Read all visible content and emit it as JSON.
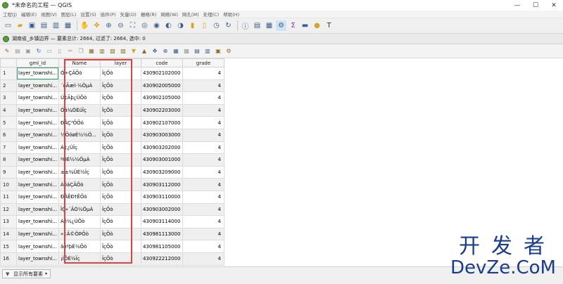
{
  "window": {
    "title": "*未命名的工程 — QGIS",
    "controls": [
      "—",
      "☐",
      "✕"
    ]
  },
  "menubar": {
    "items": [
      "工程(J)",
      "编辑(E)",
      "视图(V)",
      "图层(L)",
      "设置(S)",
      "插件(P)",
      "矢量(O)",
      "栅格(R)",
      "网络(W)",
      "网孔(M)",
      "处理(C)",
      "帮助(H)"
    ]
  },
  "toolbar": {
    "icons": [
      "new-project-icon",
      "open-project-icon",
      "save-project-icon",
      "save-as-icon",
      "print-layout-icon",
      "layout-manager-icon",
      "pan-icon",
      "pan-to-selection-icon",
      "zoom-in-icon",
      "zoom-out-icon",
      "zoom-full-icon",
      "zoom-to-selection-icon",
      "zoom-to-layer-icon",
      "zoom-last-icon",
      "zoom-next-icon",
      "new-bookmark-icon",
      "show-bookmarks-icon",
      "temporal-icon",
      "refresh-icon",
      "identify-icon",
      "attribute-table-icon",
      "field-calc-icon",
      "settings-gear-icon",
      "sum-icon",
      "measure-icon",
      "map-tips-icon",
      "text-annotation-icon"
    ]
  },
  "attribute_window": {
    "title": "湖南省_乡镇边界 — 要素总计: 2664, 过滤了: 2664, 选中: 0"
  },
  "table": {
    "columns": [
      "gml_id",
      "Name",
      "layer",
      "code",
      "grade"
    ],
    "rows": [
      {
        "num": "1",
        "gml_id": "layer_townshi...",
        "name": "Ó÷ÇÃÕò",
        "layer": "ÏçÕò",
        "code": "430902102000",
        "grade": "4"
      },
      {
        "num": "2",
        "gml_id": "layer_townshi...",
        "name": "´óÃæÌ·½ÖµÀ",
        "layer": "ÏçÕò",
        "code": "430902005000",
        "grade": "4"
      },
      {
        "num": "3",
        "gml_id": "layer_townshi...",
        "name": "Ú¢Ãþ¿ÚÕò",
        "layer": "ÏçÕò",
        "code": "430902105000",
        "grade": "4"
      },
      {
        "num": "4",
        "gml_id": "layer_townshi...",
        "name": "Öá¼ÒÈüÏç",
        "layer": "ÏçÕò",
        "code": "430902203000",
        "grade": "4"
      },
      {
        "num": "5",
        "gml_id": "layer_townshi...",
        "name": "ÐÂÇ³ÔÕò",
        "layer": "ÏçÕò",
        "code": "430902107000",
        "grade": "4"
      },
      {
        "num": "6",
        "gml_id": "layer_townshi...",
        "name": "½ÕóøÉ½½Ö...",
        "layer": "ÏçÕò",
        "code": "430903003000",
        "grade": "4"
      },
      {
        "num": "7",
        "gml_id": "layer_townshi...",
        "name": "Á¢¿ÚÏç",
        "layer": "ÏçÕò",
        "code": "430903202000",
        "grade": "4"
      },
      {
        "num": "8",
        "gml_id": "layer_townshi...",
        "name": "ºÓÉ½½ÖµÀ",
        "layer": "ÏçÕò",
        "code": "430903001000",
        "grade": "4"
      },
      {
        "num": "9",
        "gml_id": "layer_townshi...",
        "name": "±±¼ÜÉ½Ïç",
        "layer": "ÏçÕò",
        "code": "430903209000",
        "grade": "4"
      },
      {
        "num": "10",
        "gml_id": "layer_townshi...",
        "name": "ÀöáÇÃÕò",
        "layer": "ÏçÕò",
        "code": "430903112000",
        "grade": "4"
      },
      {
        "num": "11",
        "gml_id": "layer_townshi...",
        "name": "ÐÂÊÐ†ÊÕò",
        "layer": "ÏçÕò",
        "code": "430903110000",
        "grade": "4"
      },
      {
        "num": "12",
        "gml_id": "layer_townshi...",
        "name": "ÎÇ»´ÄÓ½ÖµÀ",
        "layer": "ÏçÕò",
        "code": "430903002000",
        "grade": "4"
      },
      {
        "num": "13",
        "gml_id": "layer_townshi...",
        "name": "Àé½¿ÚÕò",
        "layer": "ÏçÕò",
        "code": "430903114000",
        "grade": "4"
      },
      {
        "num": "14",
        "gml_id": "layer_townshi...",
        "name": "»¢Ã©ÖÞÕò",
        "layer": "ÏçÕò",
        "code": "430981113000",
        "grade": "4"
      },
      {
        "num": "15",
        "gml_id": "layer_townshi...",
        "name": "âóºþÉ½Õò",
        "layer": "ÏçÕò",
        "code": "430981105000",
        "grade": "4"
      },
      {
        "num": "16",
        "gml_id": "layer_townshi...",
        "name": "¡ÌÕÉ½Ïç",
        "layer": "ÏçÕò",
        "code": "430922212000",
        "grade": "4"
      }
    ]
  },
  "statusbar": {
    "filter_label": "显示所有要素"
  },
  "watermark": {
    "cn": "开发者",
    "en": "DevZe.CoM"
  },
  "colors": {
    "highlight_box": "#e34040",
    "selected_cell": "#2aa56c",
    "watermark": "#1a3c8f"
  }
}
